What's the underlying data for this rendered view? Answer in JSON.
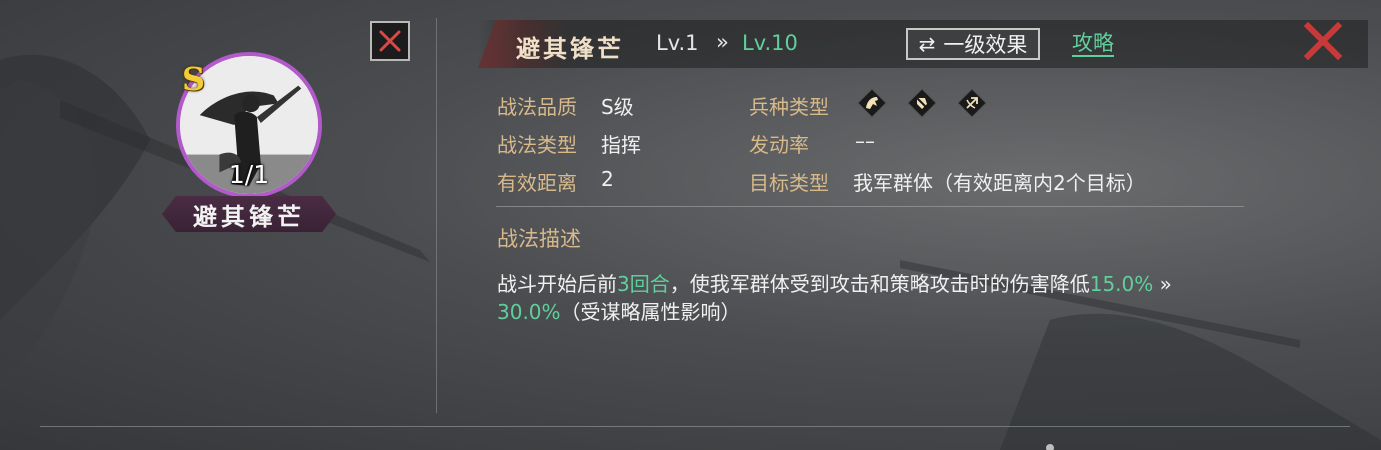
{
  "skill": {
    "grade_badge": "S",
    "portrait_count": "1/1",
    "name": "避其锋芒",
    "title": "避其锋芒",
    "level_from": "Lv.1",
    "level_arrow": "»",
    "level_to": "Lv.10"
  },
  "header": {
    "effect_button": "一级效果",
    "guide_link": "攻略"
  },
  "attributes": {
    "quality_label": "战法品质",
    "quality_value": "S级",
    "type_label": "战法类型",
    "type_value": "指挥",
    "range_label": "有效距离",
    "range_value": "2",
    "troop_label": "兵种类型",
    "troop_icons": [
      "cavalry-icon",
      "shield-icon",
      "archer-icon"
    ],
    "trigger_label": "发动率",
    "trigger_value": "––",
    "target_label": "目标类型",
    "target_value": "我军群体（有效距离内2个目标）"
  },
  "description": {
    "title": "战法描述",
    "line1_a": "战斗开始后前",
    "line1_turns": "3回合",
    "line1_b": "，使我军群体受到攻击和策略攻击时的伤害降低",
    "line1_value_from": "15.0%",
    "line1_arrow": " »",
    "line2_value_to": "30.0%",
    "line2_b": "（受谋略属性影响）"
  },
  "colors": {
    "accent_green": "#5fd09c",
    "label_gold": "#d8b98a",
    "ring_purple": "#b25ac9",
    "close_red": "#c83a3a"
  }
}
